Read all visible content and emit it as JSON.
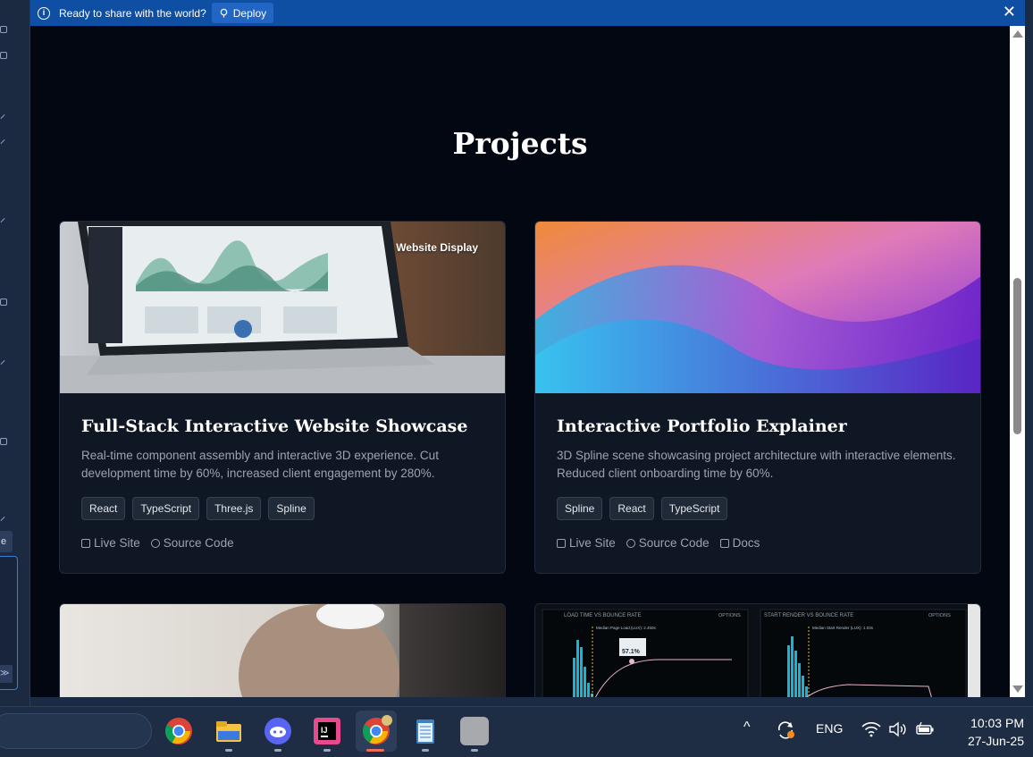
{
  "banner": {
    "message": "Ready to share with the world?",
    "deploy_label": "Deploy"
  },
  "sidebar_fragment": {
    "tab_glyph": "e",
    "go_glyph": "≫"
  },
  "section": {
    "title": "Projects"
  },
  "projects": [
    {
      "title": "Full-Stack Interactive Website Showcase",
      "image_label": "Website Display",
      "description": "Real-time component assembly and interactive 3D experience. Cut development time by 60%, increased client engagement by 280%.",
      "tags": [
        "React",
        "TypeScript",
        "Three.js",
        "Spline"
      ],
      "links": [
        "Live Site",
        "Source Code"
      ]
    },
    {
      "title": "Interactive Portfolio Explainer",
      "description": "3D Spline scene showcasing project architecture with interactive elements. Reduced client onboarding time by 60%.",
      "tags": [
        "Spline",
        "React",
        "TypeScript"
      ],
      "links": [
        "Live Site",
        "Source Code",
        "Docs"
      ]
    }
  ],
  "dashboard_card": {
    "left_panel_title": "LOAD TIME VS BOUNCE RATE",
    "right_panel_title": "START RENDER VS BOUNCE RATE",
    "options_label": "OPTIONS",
    "left_annotation": "Median Page Load (LUX): 2.450s",
    "right_annotation": "Median Start Render (LUX): 1.03s",
    "bounce_value": "57.1%"
  },
  "taskbar": {
    "apps": [
      "chrome-icon",
      "file-explorer-icon",
      "discord-icon",
      "intellij-icon",
      "chrome-profile-icon",
      "notepad-icon",
      "blank-app-icon"
    ],
    "language": "ENG",
    "time": "10:03 PM",
    "date": "27-Jun-25"
  },
  "colors": {
    "banner": "#0f4fa3",
    "page_bg": "#030712",
    "card_bg": "#0f1725",
    "taskbar": "#1e2d44"
  }
}
